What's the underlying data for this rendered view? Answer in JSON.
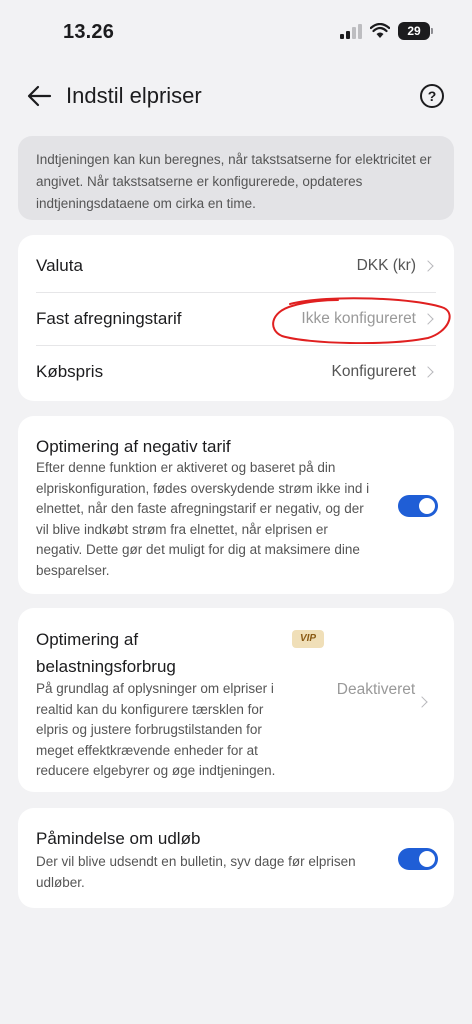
{
  "status_bar": {
    "time": "13.26",
    "battery": "29"
  },
  "header": {
    "title": "Indstil elpriser"
  },
  "info": {
    "text": "Indtjeningen kan kun beregnes, når takstsatserne for elektricitet er angivet. Når takstsatserne er konfigurerede, opdateres indtjeningsdataene om cirka en time."
  },
  "settings": {
    "rows": [
      {
        "label": "Valuta",
        "value": "DKK (kr)"
      },
      {
        "label": "Fast afregningstarif",
        "value": "Ikke konfigureret"
      },
      {
        "label": "Købspris",
        "value": "Konfigureret"
      }
    ]
  },
  "negative_tariff": {
    "title": "Optimering af negativ tarif",
    "description": "Efter denne funktion er aktiveret og baseret på din elpriskonfiguration, fødes overskydende strøm ikke ind i elnettet, når den faste afregningstarif er negativ, og der vil blive indkøbt strøm fra elnettet, når elprisen er negativ. Dette gør det muligt for dig at maksimere dine besparelser.",
    "enabled": true
  },
  "load_optimization": {
    "title": "Optimering af belastningsforbrug",
    "badge": "VIP",
    "description": "På grundlag af oplysninger om elpriser i realtid kan du konfigurere tærsklen for elpris og justere forbrugstilstanden for meget effektkrævende enheder for at reducere elgebyrer og øge indtjeningen.",
    "status": "Deaktiveret"
  },
  "expiry_reminder": {
    "title": "Påmindelse om udløb",
    "description": "Der vil blive udsendt en bulletin, syv dage før elprisen udløber.",
    "enabled": true
  },
  "colors": {
    "accent": "#1f5ed6",
    "annotation": "#e02020",
    "background": "#f2f2f4"
  }
}
